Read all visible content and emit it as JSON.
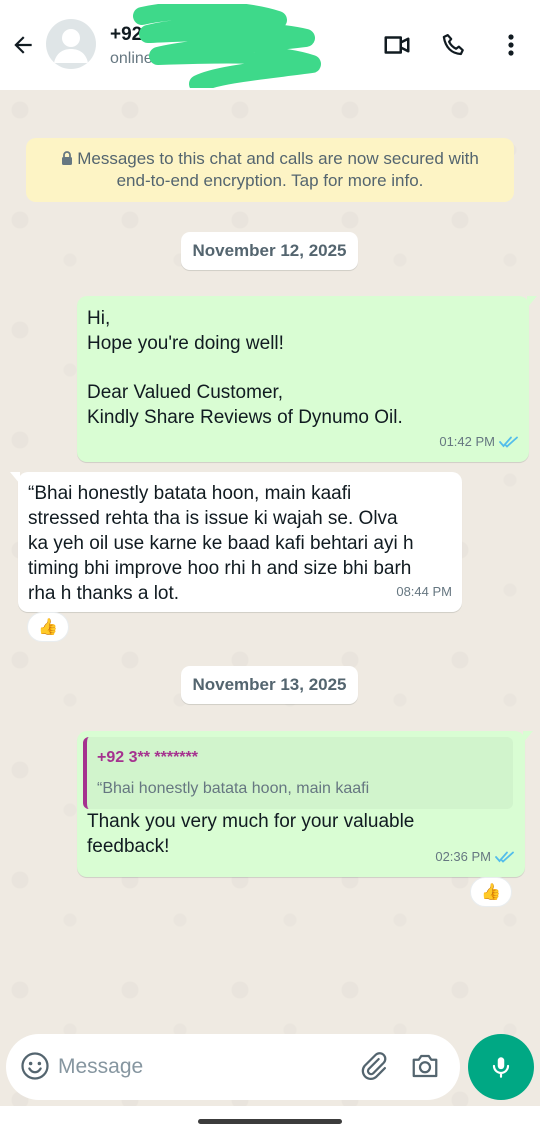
{
  "header": {
    "contact_name": "+92",
    "status": "online"
  },
  "chat": {
    "encryption_notice": [
      "Messages to this chat and calls are now secured with",
      "end-to-end encryption. Tap for more info."
    ],
    "dates": [
      "November 12, 2025",
      "November 13, 2025"
    ],
    "messages": [
      {
        "direction": "outgoing",
        "lines": [
          "Hi,",
          "Hope you're doing well!",
          "",
          "Dear Valued Customer,",
          "Kindly Share Reviews of Dynumo Oil."
        ],
        "time": "01:42 PM",
        "read": true
      },
      {
        "direction": "incoming",
        "lines": [
          "“Bhai honestly batata hoon, main kaafi",
          "stressed rehta tha is issue ki wajah se. Olva",
          "ka yeh oil use karne ke baad kafi behtari ayi h",
          "timing bhi improve hoo rhi h and size bhi barh",
          "rha h thanks a lot."
        ],
        "time": "08:44 PM",
        "reaction": "👍"
      },
      {
        "direction": "outgoing",
        "quote": {
          "sender": "+92 3** *******",
          "text": "“Bhai honestly batata hoon, main kaafi"
        },
        "lines": [
          "Thank you very much for your valuable",
          "feedback!"
        ],
        "time": "02:36 PM",
        "read": true,
        "reaction": "👍"
      }
    ]
  },
  "composer": {
    "placeholder": "Message"
  },
  "colors": {
    "accent": "#00a884",
    "outgoing_bubble": "#d9fdd3",
    "chat_background": "#efeae2",
    "read_ticks": "#53bdeb",
    "quote_sender": "#a5328f",
    "encryption_banner": "#fdf4c5"
  },
  "icons": [
    "back-arrow-icon",
    "avatar-icon",
    "video-call-icon",
    "phone-icon",
    "more-options-icon",
    "lock-icon",
    "read-ticks-icon",
    "thumbs-up-icon",
    "emoji-icon",
    "attach-icon",
    "camera-icon",
    "microphone-icon"
  ]
}
